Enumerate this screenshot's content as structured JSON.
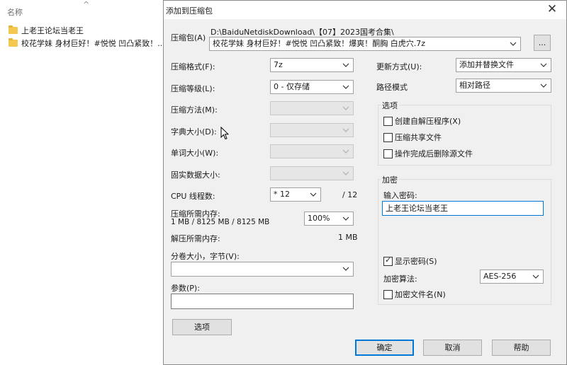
{
  "explorer": {
    "column_header": "名称",
    "sort_arrow": "^",
    "files": [
      "上老王论坛当老王",
      "校花学妹 身材巨好！#悦悦 凹凸紧致！..."
    ]
  },
  "dialog": {
    "title": "添加到压缩包",
    "close": "✕",
    "archive": {
      "label": "压缩包(A)",
      "path": "D:\\BaiduNetdiskDownload\\【07】2023国考合集\\",
      "filename": "校花学妹 身材巨好！#悦悦 凹凸紧致！爆爽！酮胸 白虎穴.7z",
      "browse_label": "..."
    },
    "left": {
      "format_label": "压缩格式(F):",
      "format_value": "7z",
      "level_label": "压缩等级(L):",
      "level_value": "0 - 仅存储",
      "method_label": "压缩方法(M):",
      "dict_label": "字典大小(D):",
      "word_label": "单词大小(W):",
      "solid_label": "固实数据大小:",
      "cpu_label": "CPU 线程数:",
      "cpu_value": "* 12",
      "cpu_total": "/ 12",
      "mem_label": "压缩所需内存:",
      "mem_value": "1 MB / 8125 MB / 8125 MB",
      "mem_percent": "100%",
      "decomp_label": "解压所需内存:",
      "decomp_value": "1 MB",
      "split_label": "分卷大小，字节(V):",
      "split_value": "",
      "params_label": "参数(P):",
      "params_value": "",
      "options_button": "选项"
    },
    "right": {
      "update_label": "更新方式(U):",
      "update_value": "添加并替换文件",
      "path_label": "路径模式",
      "path_value": "相对路径",
      "options_group": "选项",
      "opt_sfx": "创建自解压程序(X)",
      "opt_shared": "压缩共享文件",
      "opt_delete": "操作完成后删除源文件",
      "encryption_group": "加密",
      "password_label": "输入密码:",
      "password_value": "上老王论坛当老王",
      "show_password": "显示密码(S)",
      "enc_method_label": "加密算法:",
      "enc_method_value": "AES-256",
      "encrypt_names": "加密文件名(N)"
    },
    "buttons": {
      "ok": "确定",
      "cancel": "取消",
      "help": "帮助"
    }
  }
}
